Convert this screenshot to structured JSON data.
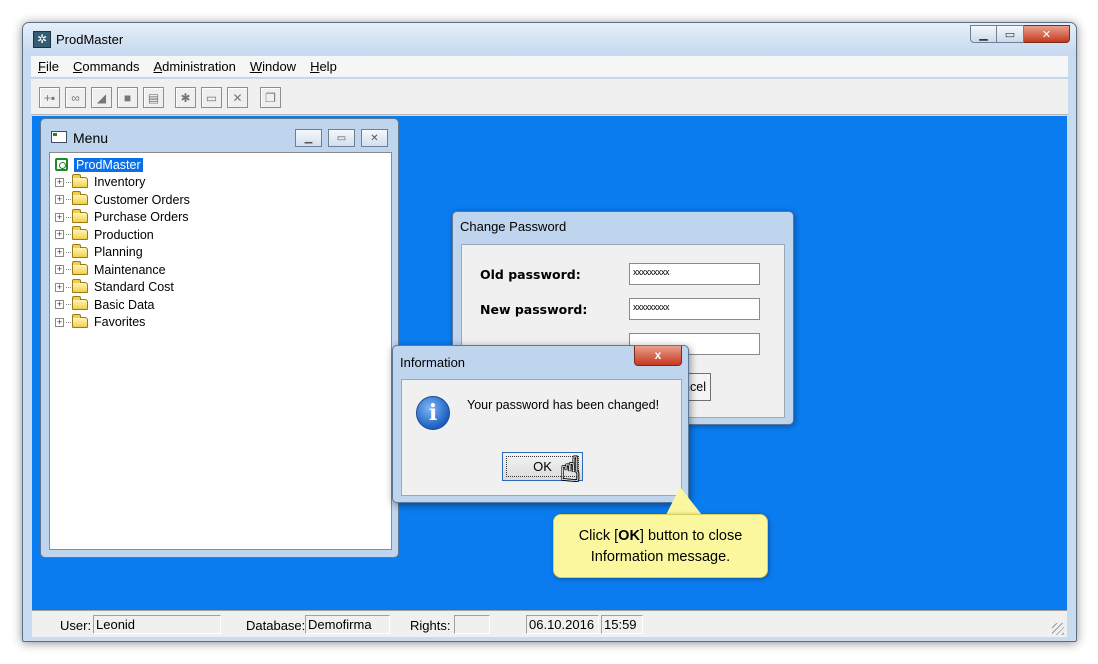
{
  "app": {
    "title": "ProdMaster",
    "window_controls": [
      "minimize-icon",
      "maximize-icon",
      "close-icon"
    ]
  },
  "menubar": [
    {
      "label": "File",
      "u": "F",
      "rest": "ile"
    },
    {
      "label": "Commands",
      "u": "C",
      "rest": "ommands"
    },
    {
      "label": "Administration",
      "u": "A",
      "rest": "dministration"
    },
    {
      "label": "Window",
      "u": "W",
      "rest": "indow"
    },
    {
      "label": "Help",
      "u": "H",
      "rest": "elp"
    }
  ],
  "toolbar": {
    "icons": [
      "add-icon",
      "binoculars-icon",
      "eraser-icon",
      "stop-icon",
      "document-icon",
      "new-folder-icon",
      "folder-icon",
      "delete-icon",
      "windows-icon"
    ]
  },
  "menu_window": {
    "title": "Menu",
    "root": "ProdMaster",
    "items": [
      "Inventory",
      "Customer Orders",
      "Purchase Orders",
      "Production",
      "Planning",
      "Maintenance",
      "Standard Cost",
      "Basic Data",
      "Favorites"
    ]
  },
  "change_password": {
    "title": "Change Password",
    "old_label": "Old password:",
    "old_value": "xxxxxxxxx",
    "new_label": "New password:",
    "new_value": "xxxxxxxxx",
    "cancel_label": "ancel"
  },
  "info_dialog": {
    "title": "Information",
    "close": "x",
    "message": "Your password has been changed!",
    "ok_label": "OK"
  },
  "callout": {
    "pre": "Click [",
    "bold": "OK",
    "post": "] button to close",
    "line2": "Information message."
  },
  "status": {
    "user_label": "User:",
    "user": "Leonid",
    "db_label": "Database:",
    "db": "Demofirma",
    "rights_label": "Rights:",
    "rights": "",
    "date": "06.10.2016",
    "time": "15:59"
  },
  "colors": {
    "desktop": "#0a7cf0",
    "callout": "#fbf79e",
    "selection": "#0a70ea"
  }
}
